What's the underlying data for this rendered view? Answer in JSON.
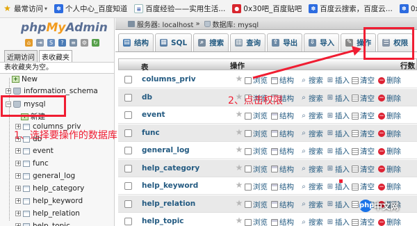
{
  "bookmarks": [
    {
      "icon": "star-icon",
      "label": "最常访问",
      "style": "star"
    },
    {
      "icon": "paw-icon",
      "label": "个人中心_百度知道",
      "style": "paw"
    },
    {
      "icon": "document-icon",
      "label": "百度经验——实用生活...",
      "style": "doc"
    },
    {
      "icon": "red-logo-icon",
      "label": "0x30吧_百度贴吧",
      "style": "red"
    },
    {
      "icon": "paw-icon",
      "label": "百度云搜索，百度云...",
      "style": "paw"
    },
    {
      "icon": "paw-icon",
      "label": "0x30_知道团队_百度",
      "style": "paw"
    }
  ],
  "sidebar": {
    "logo_php": "php",
    "logo_my": "My",
    "logo_admin": "Admin",
    "tabs": [
      "近期访问",
      "表收藏夹"
    ],
    "favorites_empty": "表收藏夹为空。",
    "tree": [
      {
        "label": "New",
        "type": "new"
      },
      {
        "label": "information_schema",
        "type": "db"
      },
      {
        "label": "mysql",
        "type": "db"
      },
      {
        "label": "新建",
        "type": "new"
      },
      {
        "label": "columns_priv",
        "type": "table"
      },
      {
        "label": "db",
        "type": "table"
      },
      {
        "label": "event",
        "type": "table"
      },
      {
        "label": "func",
        "type": "table"
      },
      {
        "label": "general_log",
        "type": "table"
      },
      {
        "label": "help_category",
        "type": "table"
      },
      {
        "label": "help_keyword",
        "type": "table"
      },
      {
        "label": "help_relation",
        "type": "table"
      },
      {
        "label": "help_topic",
        "type": "table"
      }
    ]
  },
  "breadcrumb": {
    "server": "服务器: localhost",
    "sep": "»",
    "database": "数据库: mysql"
  },
  "tabs": [
    {
      "label": "结构",
      "icon": "structure-icon",
      "color": "#4d7fb2"
    },
    {
      "label": "SQL",
      "icon": "sql-icon",
      "color": "#5a7fa6"
    },
    {
      "label": "搜索",
      "icon": "search-icon",
      "color": "#7a8da0"
    },
    {
      "label": "查询",
      "icon": "query-icon",
      "color": "#8fa0b0"
    },
    {
      "label": "导出",
      "icon": "export-icon",
      "color": "#6d8aa6"
    },
    {
      "label": "导入",
      "icon": "import-icon",
      "color": "#6d8aa6"
    },
    {
      "label": "操作",
      "icon": "wrench-icon",
      "color": "#888"
    },
    {
      "label": "权限",
      "icon": "privileges-icon",
      "color": "#8896a8"
    }
  ],
  "table_header": {
    "name": "表",
    "sort_arrow": "▲",
    "actions": "操作",
    "rows": "行数"
  },
  "actions": {
    "browse": "浏览",
    "structure": "结构",
    "search": "搜索",
    "insert": "插入",
    "empty": "清空",
    "drop": "删除"
  },
  "tables": [
    "columns_priv",
    "db",
    "event",
    "func",
    "general_log",
    "help_category",
    "help_keyword",
    "help_relation",
    "help_topic"
  ],
  "annotations": {
    "step1": "1、选择要操作的数据库",
    "step2": "2、点击权限",
    "accent": "#f01d32"
  },
  "watermark": {
    "logo": "php",
    "text": "中文网"
  }
}
